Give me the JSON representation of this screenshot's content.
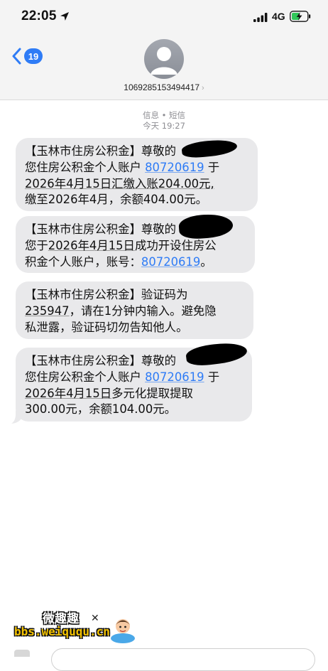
{
  "status_bar": {
    "time": "22:05",
    "network": "4G"
  },
  "header": {
    "back_badge": "19",
    "contact_number": "1069285153494417",
    "contact_chevron": "›"
  },
  "meta": {
    "service": "信息 • 短信",
    "timestamp": "今天 19:27"
  },
  "messages": [
    {
      "lines": [
        [
          "【玉林市住房公积金】尊敬的"
        ],
        [
          "您住房公积金个人账户 ",
          "80720619",
          " 于"
        ],
        [
          "2026年4月15日汇缴入账204.00元,"
        ],
        [
          "缴至2026年4月，余额404.00元。"
        ]
      ]
    },
    {
      "lines": [
        [
          "【玉林市住房公积金】尊敬的"
        ],
        [
          "您于",
          "2026年4月15日",
          "成功开设住房公"
        ],
        [
          "积金个人账户，账号：",
          "80720619",
          "。"
        ]
      ]
    },
    {
      "lines": [
        [
          "【玉林市住房公积金】验证码为"
        ],
        [
          "235947",
          "，请在1分钟内输入。避免隐"
        ],
        [
          "私泄露，验证码切勿告知他人。"
        ]
      ]
    },
    {
      "lines": [
        [
          "【玉林市住房公积金】尊敬的"
        ],
        [
          "您住房公积金个人账户 ",
          "80720619",
          " 于"
        ],
        [
          "2026年4月15日",
          "多元化提取提取"
        ],
        [
          "300.00元，余额104.00元。"
        ]
      ]
    }
  ],
  "watermark": {
    "top": "微趣趣",
    "url": "bbs.weiququ.cn"
  },
  "colors": {
    "accent": "#2f7cf6",
    "bubble": "#e9e9eb",
    "header_bg": "#f4f4f4"
  },
  "icons": [
    "location-arrow-icon",
    "signal-icon",
    "battery-charging-icon",
    "back-chevron-icon",
    "person-avatar-icon",
    "camera-icon"
  ]
}
